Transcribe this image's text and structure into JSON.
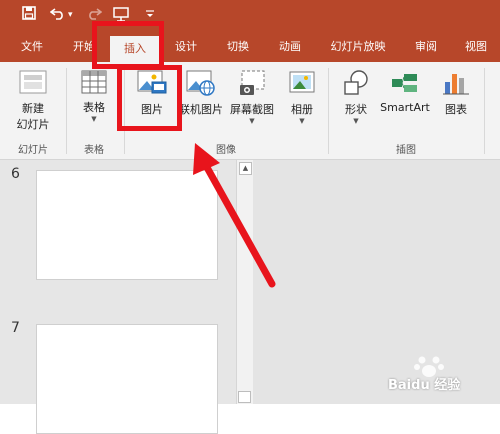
{
  "colors": {
    "accent": "#b7472a",
    "ribbon_bg": "#f3f3f3",
    "annotation": "#e8141c"
  },
  "quick_access": {
    "icons": [
      "save-icon",
      "undo-icon",
      "redo-icon",
      "slideshow-icon",
      "customize-icon"
    ],
    "undo_caret": "▾"
  },
  "tabs": [
    {
      "label": "文件"
    },
    {
      "label": "开始"
    },
    {
      "label": "插入",
      "active": true
    },
    {
      "label": "设计"
    },
    {
      "label": "切换"
    },
    {
      "label": "动画"
    },
    {
      "label": "幻灯片放映"
    },
    {
      "label": "审阅"
    },
    {
      "label": "视图"
    }
  ],
  "ribbon": {
    "groups": [
      {
        "label": "幻灯片",
        "buttons": [
          {
            "label_line1": "新建",
            "label_line2": "幻灯片",
            "icon": "new-slide-icon",
            "dropdown": true
          }
        ]
      },
      {
        "label": "表格",
        "buttons": [
          {
            "label": "表格",
            "icon": "table-icon",
            "dropdown": true
          }
        ]
      },
      {
        "label": "图像",
        "buttons": [
          {
            "label": "图片",
            "icon": "picture-icon"
          },
          {
            "label": "联机图片",
            "icon": "online-picture-icon"
          },
          {
            "label": "屏幕截图",
            "icon": "screenshot-icon",
            "dropdown": true
          },
          {
            "label": "相册",
            "icon": "photo-album-icon",
            "dropdown": true
          }
        ]
      },
      {
        "label": "插图",
        "buttons": [
          {
            "label": "形状",
            "icon": "shapes-icon",
            "dropdown": true
          },
          {
            "label": "SmartArt",
            "icon": "smartart-icon"
          },
          {
            "label": "图表",
            "icon": "chart-icon"
          }
        ]
      }
    ]
  },
  "slides": [
    {
      "number": "6"
    },
    {
      "number": "7"
    }
  ],
  "watermark": {
    "text": "Baidu 经验"
  }
}
